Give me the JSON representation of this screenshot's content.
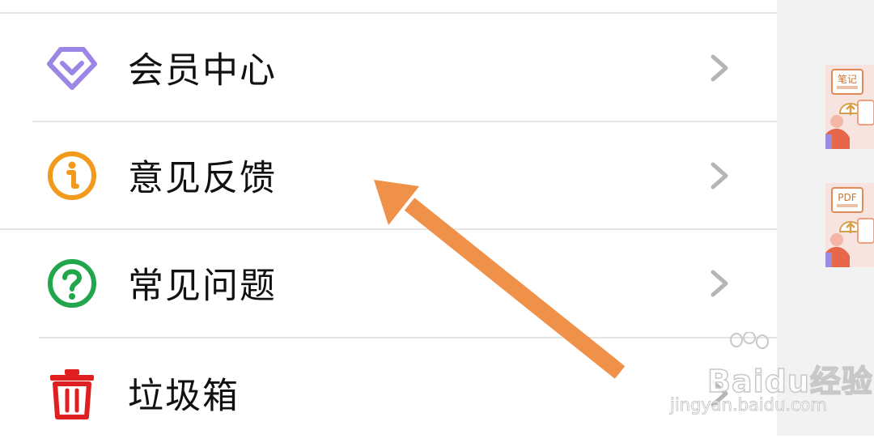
{
  "menu": {
    "items": [
      {
        "label": "会员中心",
        "icon": "vip-diamond-icon",
        "color": "#9b86e6"
      },
      {
        "label": "意见反馈",
        "icon": "info-circle-icon",
        "color": "#f29a1b"
      },
      {
        "label": "常见问题",
        "icon": "help-circle-icon",
        "color": "#21a64c"
      },
      {
        "label": "垃圾箱",
        "icon": "trash-icon",
        "color": "#e02020"
      }
    ],
    "chevron_icon": "chevron-right-icon"
  },
  "thumbnails": [
    {
      "icon": "note-document-thumbnail",
      "label": "笔记"
    },
    {
      "icon": "pdf-document-thumbnail",
      "label": "PDF"
    }
  ],
  "annotation": {
    "type": "arrow",
    "color": "#f0914a"
  },
  "watermark": {
    "brand": "Baidu经验",
    "url": "jingyan.baidu.com"
  }
}
